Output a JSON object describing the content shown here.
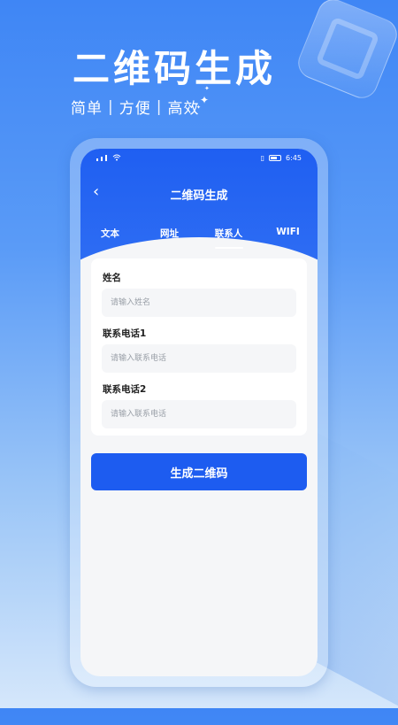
{
  "hero": {
    "title": "二维码生成",
    "tagline": [
      "简单",
      "方便",
      "高效"
    ],
    "separator": "|"
  },
  "phone": {
    "status_bar": {
      "time": "6:45",
      "icons": [
        "signal-icon",
        "wifi-icon",
        "vibrate-icon",
        "battery-icon"
      ]
    },
    "header": {
      "back_glyph": "‹",
      "title": "二维码生成"
    },
    "tabs": [
      {
        "label": "文本",
        "active": false
      },
      {
        "label": "网址",
        "active": false
      },
      {
        "label": "联系人",
        "active": true
      },
      {
        "label": "WIFI",
        "active": false
      }
    ],
    "form": {
      "fields": [
        {
          "label": "姓名",
          "placeholder": "请输入姓名",
          "value": ""
        },
        {
          "label": "联系电话1",
          "placeholder": "请输入联系电话",
          "value": ""
        },
        {
          "label": "联系电话2",
          "placeholder": "请输入联系电话",
          "value": ""
        }
      ]
    },
    "generate_button": "生成二维码"
  },
  "colors": {
    "primary": "#1d5cf0",
    "background_top": "#3f86f5",
    "page_bg": "#f5f6f8"
  }
}
